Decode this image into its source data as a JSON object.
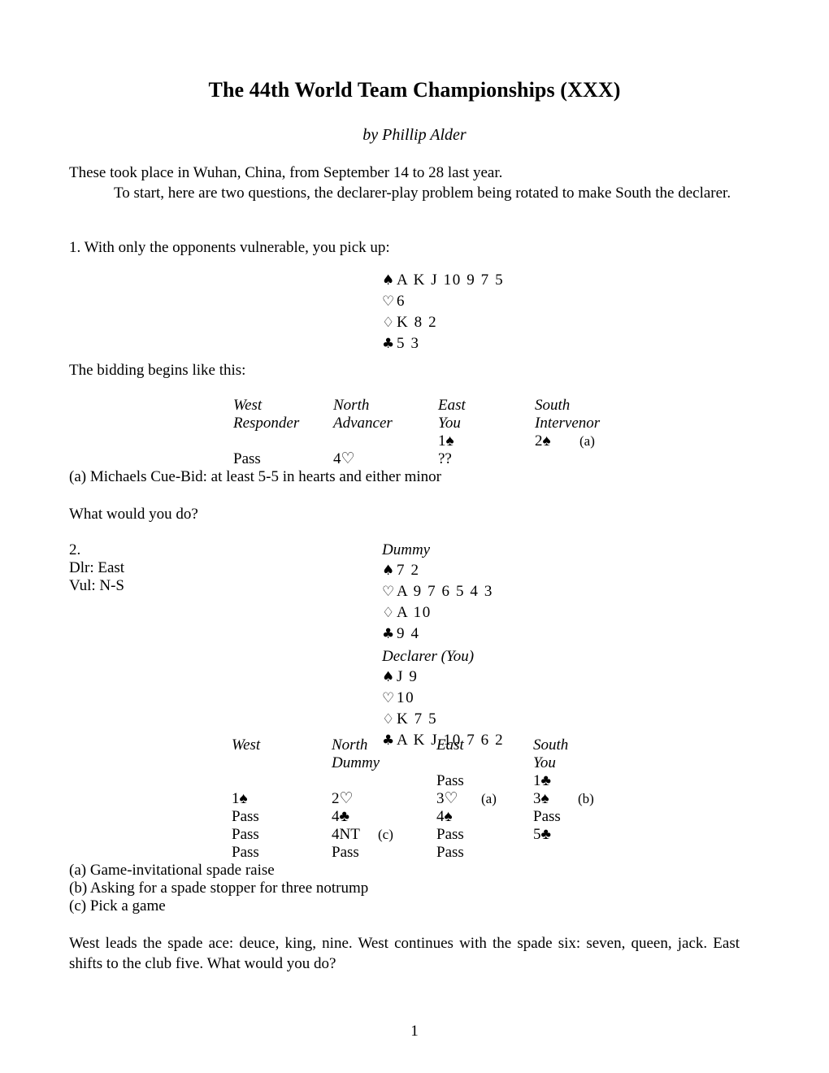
{
  "document": {
    "title": "The 44th World Team Championships (XXX)",
    "byline": "by Phillip Alder",
    "page_number": "1"
  },
  "intro": {
    "para1": "These took place in Wuhan, China, from September 14 to 28 last year.",
    "para2": "To start, here are two questions, the declarer-play problem being rotated to make South the declarer."
  },
  "problem1": {
    "prompt": "1. With only the opponents vulnerable, you pick up:",
    "hand": {
      "spades_symbol": "♠",
      "spades": "A K J 10 9 7 5",
      "hearts_symbol": "♡",
      "hearts": "6",
      "diamonds_symbol": "♢",
      "diamonds": "K 8 2",
      "clubs_symbol": "♣",
      "clubs": "5 3"
    },
    "bidding_intro": "The bidding begins like this:",
    "auction": {
      "header1": [
        "West",
        "North",
        "East",
        "South"
      ],
      "header2": [
        "Responder",
        "Advancer",
        "You",
        "Intervenor"
      ],
      "rows": [
        {
          "west": "",
          "north": "",
          "east": "1♠",
          "east_note": "",
          "south": "2♠",
          "south_note": "(a)"
        },
        {
          "west": "Pass",
          "north": "4♡",
          "east": "??",
          "east_note": "",
          "south": "",
          "south_note": ""
        }
      ]
    },
    "footnotes": [
      "(a) Michaels Cue-Bid: at least 5-5 in hearts and either minor"
    ],
    "question": "What would you do?"
  },
  "problem2": {
    "number": "2.",
    "dealer": "Dlr: East",
    "vulnerability": "Vul: N-S",
    "dummy": {
      "label": "Dummy",
      "spades_symbol": "♠",
      "spades": "7 2",
      "hearts_symbol": "♡",
      "hearts": "A 9 7 6 5 4 3",
      "diamonds_symbol": "♢",
      "diamonds": "A 10",
      "clubs_symbol": "♣",
      "clubs": "9 4"
    },
    "declarer": {
      "label": "Declarer (You)",
      "spades_symbol": "♠",
      "spades": "J 9",
      "hearts_symbol": "♡",
      "hearts": "10",
      "diamonds_symbol": "♢",
      "diamonds": "K 7 5",
      "clubs_symbol": "♣",
      "clubs": "A K J 10 7 6 2"
    },
    "auction": {
      "header1": [
        "West",
        "North",
        "East",
        "South"
      ],
      "header2": [
        "",
        "Dummy",
        "",
        "You"
      ],
      "rows": [
        {
          "west": "",
          "north": "",
          "north_note": "",
          "east": "Pass",
          "east_note": "",
          "south": "1♣",
          "south_note": ""
        },
        {
          "west": "1♠",
          "north": "2♡",
          "north_note": "",
          "east": "3♡",
          "east_note": "(a)",
          "south": "3♠",
          "south_note": "(b)"
        },
        {
          "west": "Pass",
          "north": "4♣",
          "north_note": "",
          "east": "4♠",
          "east_note": "",
          "south": "Pass",
          "south_note": ""
        },
        {
          "west": "Pass",
          "north": "4NT",
          "north_note": "(c)",
          "east": "Pass",
          "east_note": "",
          "south": "5♣",
          "south_note": ""
        },
        {
          "west": "Pass",
          "north": "Pass",
          "north_note": "",
          "east": "Pass",
          "east_note": "",
          "south": "",
          "south_note": ""
        }
      ]
    },
    "footnotes": [
      "(a) Game-invitational spade raise",
      "(b) Asking for a spade stopper for three notrump",
      "(c) Pick a game"
    ],
    "closing": "West leads the spade ace: deuce, king, nine. West continues with the spade six: seven, queen, jack. East shifts to the club five. What would you do?"
  }
}
